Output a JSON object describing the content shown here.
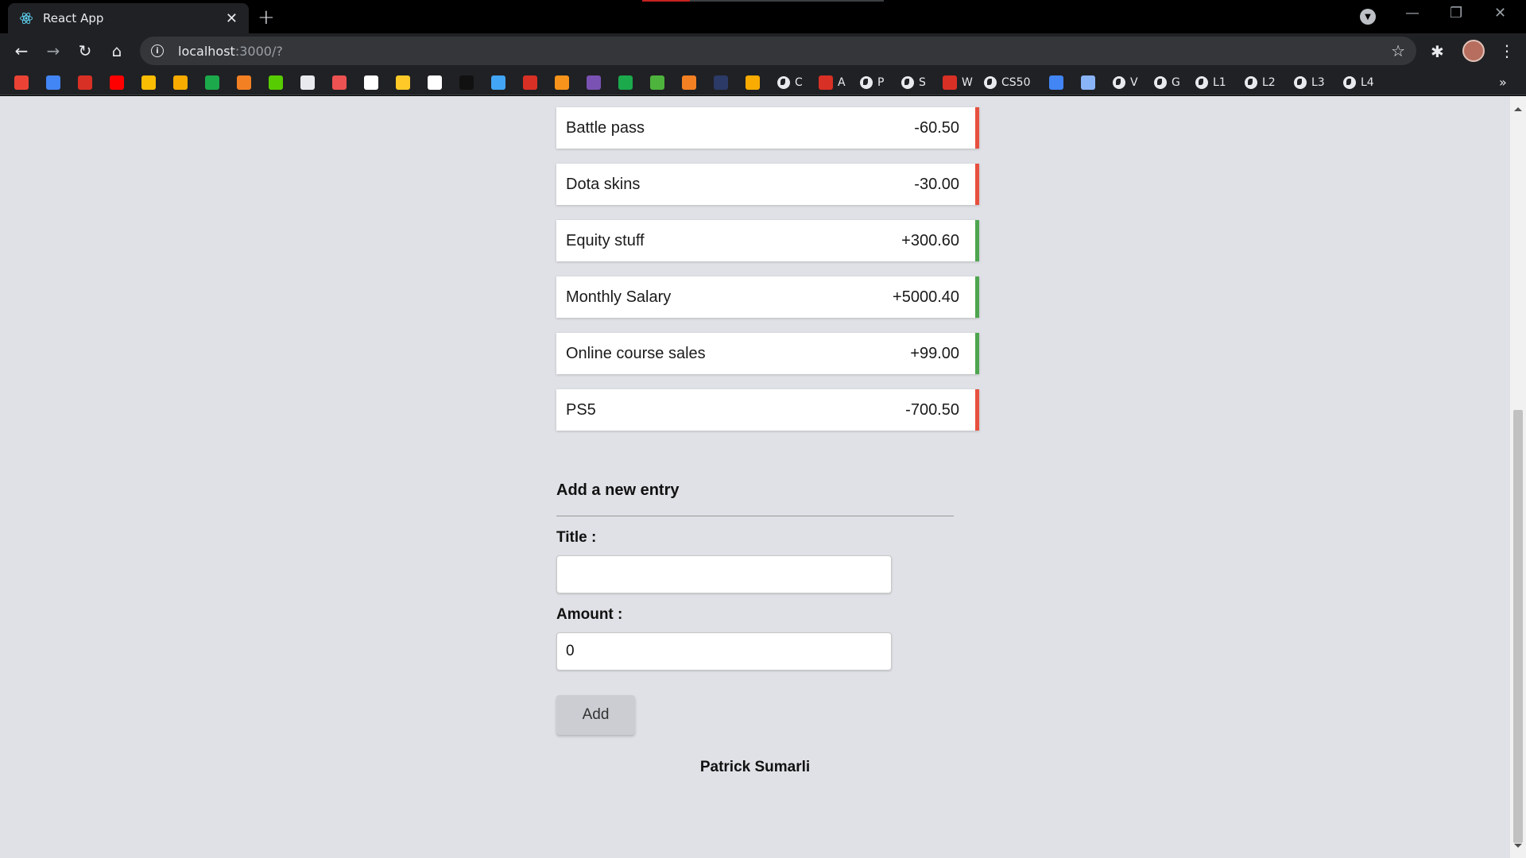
{
  "browser": {
    "tab_title": "React App",
    "url_host": "localhost",
    "url_path": ":3000/?",
    "bookmarks": [
      {
        "label": "",
        "icon": "gmail-icon",
        "color": "#ea4335"
      },
      {
        "label": "",
        "icon": "gmail-icon",
        "color": "#4285f4"
      },
      {
        "label": "",
        "icon": "crest-icon",
        "color": "#d93025"
      },
      {
        "label": "",
        "icon": "youtube-icon",
        "color": "#ff0000"
      },
      {
        "label": "",
        "icon": "drive-icon",
        "color": "#fbbc04"
      },
      {
        "label": "",
        "icon": "chart-icon",
        "color": "#f9ab00"
      },
      {
        "label": "",
        "icon": "hackerrank-icon",
        "color": "#1ba94c"
      },
      {
        "label": "",
        "icon": "stackoverflow-icon",
        "color": "#f48024"
      },
      {
        "label": "",
        "icon": "duolingo-icon",
        "color": "#58cc02"
      },
      {
        "label": "",
        "icon": "clipboard-icon",
        "color": "#e8eaed"
      },
      {
        "label": "",
        "icon": "udemy-icon",
        "color": "#ec5252"
      },
      {
        "label": "",
        "icon": "github-icon",
        "color": "#ffffff"
      },
      {
        "label": "",
        "icon": "firebase-icon",
        "color": "#ffca28"
      },
      {
        "label": "",
        "icon": "angular-icon",
        "color": "#ffffff"
      },
      {
        "label": "",
        "icon": "bird-icon",
        "color": "#111111"
      },
      {
        "label": "",
        "icon": "flutter-icon",
        "color": "#42a5f5"
      },
      {
        "label": "",
        "icon": "notion-icon",
        "color": "#d93025"
      },
      {
        "label": "",
        "icon": "bitcoin-icon",
        "color": "#f7931a"
      },
      {
        "label": "",
        "icon": "bootstrap-icon",
        "color": "#7952b3"
      },
      {
        "label": "",
        "icon": "w-icon",
        "color": "#1ba94c"
      },
      {
        "label": "",
        "icon": "mongodb-icon",
        "color": "#4db33d"
      },
      {
        "label": "",
        "icon": "stack-icon",
        "color": "#f48024"
      },
      {
        "label": "",
        "icon": "grid-icon",
        "color": "#2b3a67"
      },
      {
        "label": "",
        "icon": "shield-icon",
        "color": "#f9ab00"
      },
      {
        "label": "C",
        "icon": "globe-icon",
        "color": "#e8eaed"
      },
      {
        "label": "A",
        "icon": "crest-icon",
        "color": "#d93025"
      },
      {
        "label": "P",
        "icon": "globe-icon",
        "color": "#e8eaed"
      },
      {
        "label": "S",
        "icon": "globe-icon",
        "color": "#e8eaed"
      },
      {
        "label": "W",
        "icon": "crest-icon",
        "color": "#d93025"
      },
      {
        "label": "CS50",
        "icon": "globe-icon",
        "color": "#e8eaed"
      },
      {
        "label": "",
        "icon": "docs-icon",
        "color": "#4285f4"
      },
      {
        "label": "",
        "icon": "circle-icon",
        "color": "#8ab4f8"
      },
      {
        "label": "V",
        "icon": "globe-icon",
        "color": "#e8eaed"
      },
      {
        "label": "G",
        "icon": "globe-icon",
        "color": "#e8eaed"
      },
      {
        "label": "L1",
        "icon": "globe-icon",
        "color": "#e8eaed"
      },
      {
        "label": "L2",
        "icon": "globe-icon",
        "color": "#e8eaed"
      },
      {
        "label": "L3",
        "icon": "globe-icon",
        "color": "#e8eaed"
      },
      {
        "label": "L4",
        "icon": "globe-icon",
        "color": "#e8eaed"
      }
    ]
  },
  "entries": [
    {
      "title": "Battle pass",
      "amount": "-60.50",
      "type": "expense"
    },
    {
      "title": "Dota skins",
      "amount": "-30.00",
      "type": "expense"
    },
    {
      "title": "Equity stuff",
      "amount": "+300.60",
      "type": "income"
    },
    {
      "title": "Monthly Salary",
      "amount": "+5000.40",
      "type": "income"
    },
    {
      "title": "Online course sales",
      "amount": "+99.00",
      "type": "income"
    },
    {
      "title": "PS5",
      "amount": "-700.50",
      "type": "expense"
    }
  ],
  "form": {
    "heading": "Add a new entry",
    "title_label": "Title :",
    "title_value": "",
    "amount_label": "Amount :",
    "amount_value": "0",
    "add_label": "Add"
  },
  "footer": {
    "author": "Patrick Sumarli"
  },
  "colors": {
    "expense": "#e7503f",
    "income": "#4ea54f",
    "page_bg": "#dfe1e6"
  }
}
